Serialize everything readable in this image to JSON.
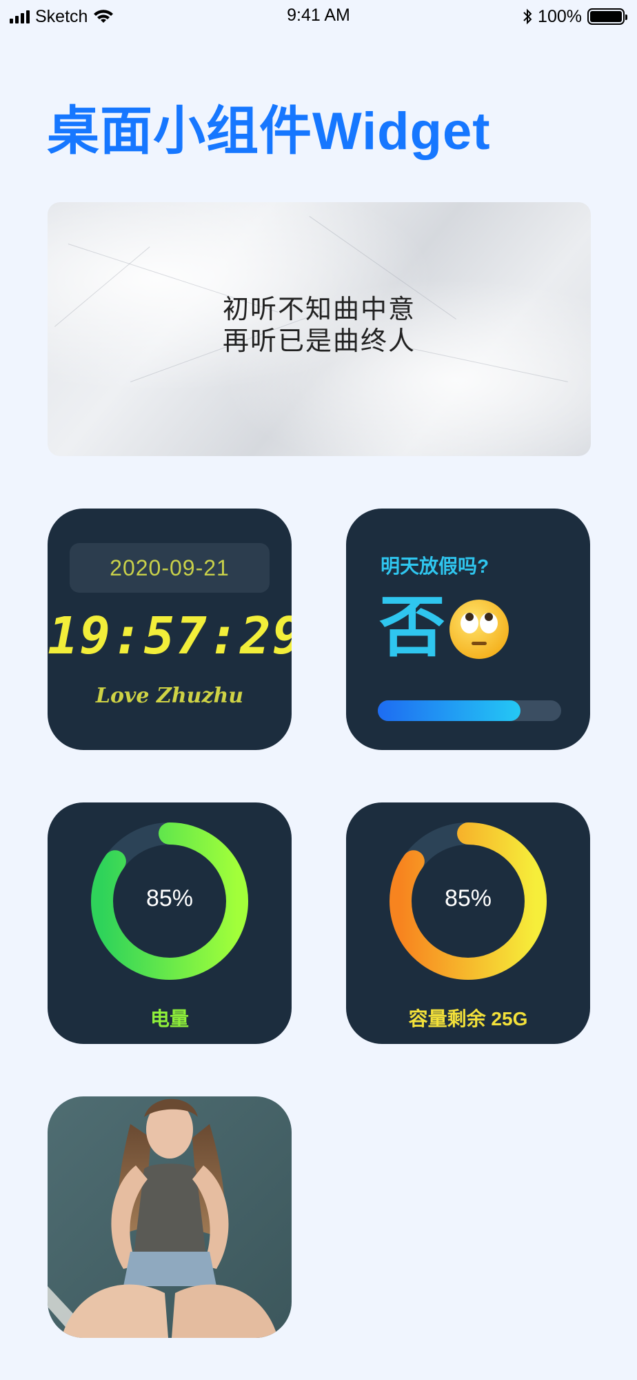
{
  "status_bar": {
    "carrier": "Sketch",
    "time": "9:41 AM",
    "battery": "100%"
  },
  "page": {
    "title": "桌面小组件Widget"
  },
  "quote_widget": {
    "line1": "初听不知曲中意",
    "line2": "再听已是曲终人"
  },
  "clock_widget": {
    "date": "2020-09-21",
    "time": "19:57:29",
    "signature": "Love Zhuzhu"
  },
  "holiday_widget": {
    "question": "明天放假吗?",
    "answer": "否",
    "emoji": "face-with-rolling-eyes-icon",
    "progress": 0.78,
    "colors": {
      "start": "#1e6cf2",
      "end": "#24c8f4"
    }
  },
  "battery_widget": {
    "percent_label": "85%",
    "value": 0.85,
    "caption": "电量",
    "colors": {
      "start": "#2fd35a",
      "end": "#a2ff3a",
      "track": "#2c4357"
    }
  },
  "storage_widget": {
    "percent_label": "85%",
    "value": 0.85,
    "caption": "容量剩余 25G",
    "colors": {
      "start": "#f7841f",
      "end": "#f6ee3a",
      "track": "#2c4357"
    }
  },
  "photo_widget": {
    "subject": "photo-of-sitting-girl"
  }
}
